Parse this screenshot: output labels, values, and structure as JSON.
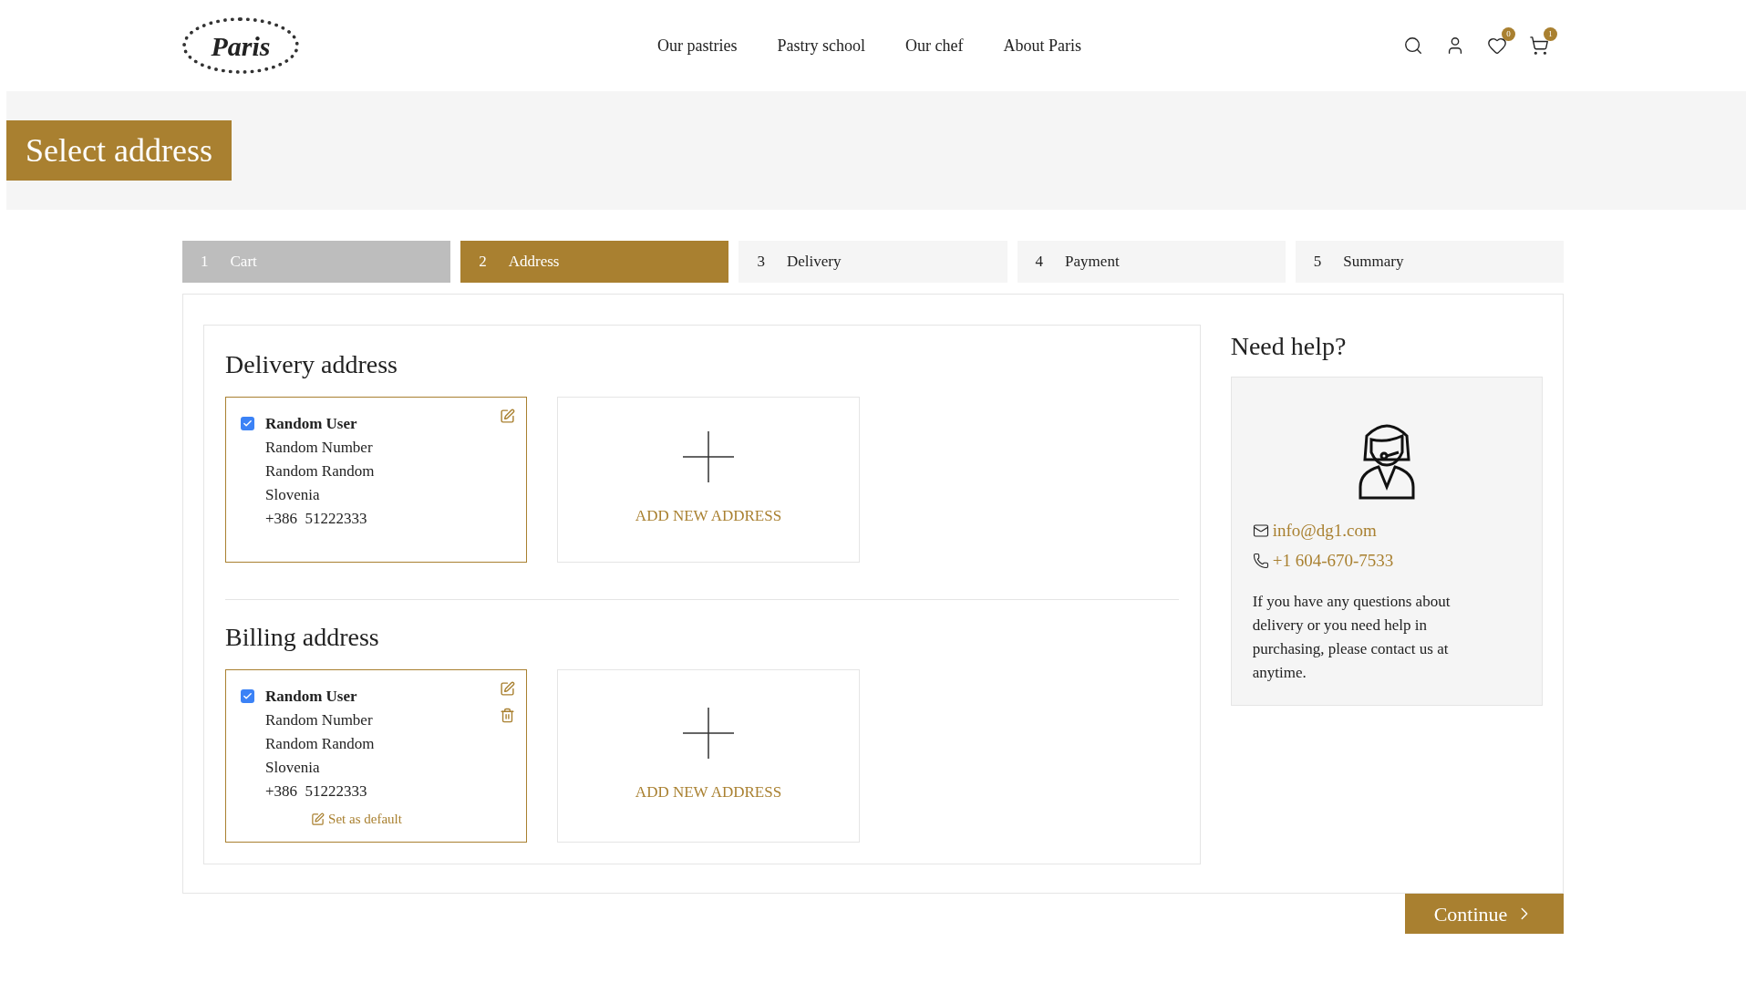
{
  "header": {
    "logo": "Paris",
    "nav": [
      {
        "label": "Our pastries"
      },
      {
        "label": "Pastry school"
      },
      {
        "label": "Our chef"
      },
      {
        "label": "About Paris"
      }
    ],
    "wishlist_count": "0",
    "cart_count": "1"
  },
  "page_title": "Select address",
  "steps": [
    {
      "number": "1",
      "label": "Cart",
      "selected": false,
      "completed": true
    },
    {
      "number": "2",
      "label": "Address",
      "selected": true,
      "completed": false
    },
    {
      "number": "3",
      "label": "Delivery",
      "selected": false,
      "completed": false
    },
    {
      "number": "4",
      "label": "Payment",
      "selected": false,
      "completed": false
    },
    {
      "number": "5",
      "label": "Summary",
      "selected": false,
      "completed": false
    }
  ],
  "sections": [
    {
      "title": "Delivery address",
      "addresses": [
        {
          "checked": true,
          "removable": false,
          "name": "Random User",
          "lines": [
            "Random Number",
            "Random Random",
            "Slovenia",
            "+386  51222333"
          ]
        }
      ],
      "add_label": "ADD NEW ADDRESS"
    },
    {
      "title": "Billing address",
      "addresses": [
        {
          "checked": true,
          "removable": true,
          "name": "Random User",
          "lines": [
            "Random Number",
            "Random Random",
            "Slovenia",
            "+386  51222333"
          ],
          "set_default": "Set as default"
        }
      ],
      "add_label": "ADD NEW ADDRESS"
    }
  ],
  "help": {
    "title": "Need help?",
    "email": "info@dg1.com",
    "phone": "+1 604-670-7533",
    "text": "If you have any questions about delivery or you need help in purchasing, please contact us at anytime."
  },
  "continue_button": "Continue"
}
